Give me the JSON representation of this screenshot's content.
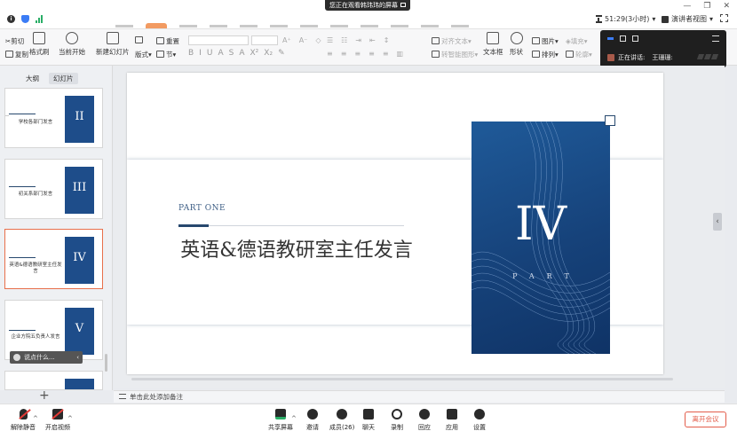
{
  "meeting": {
    "share_banner": "您正在观看韩玮玮的屏幕",
    "timer": "51:29(3小时)",
    "presenter_view": "演讲者视图"
  },
  "ribbon": {
    "cut": "剪切",
    "copy": "复制",
    "format_painter": "格式刷",
    "from_current": "当前开始",
    "new_slide": "新建幻灯片",
    "layout": "版式",
    "section": "节",
    "reset": "重置",
    "text_box": "文本框",
    "shape": "形状",
    "picture": "图片",
    "arrange": "排列",
    "align_text": "对齐文本",
    "smartart": "转智能图形",
    "fill": "填充",
    "outline": "轮廓"
  },
  "speaker_panel": {
    "label": "正在讲话:",
    "name": "王珊珊:"
  },
  "pane": {
    "tab_outline": "大纲",
    "tab_slides": "幻灯片",
    "add_slide": "+",
    "comment_placeholder": "说点什么..."
  },
  "thumbnails": [
    {
      "title": "学校各部门发言",
      "numeral": "II"
    },
    {
      "title": "初关系部门发言",
      "numeral": "III"
    },
    {
      "title": "英语&德语教研室主任发言",
      "numeral": "IV"
    },
    {
      "title": "企业方院五负责人发言",
      "numeral": "V"
    },
    {
      "title": "",
      "numeral": ""
    }
  ],
  "slide": {
    "part_label": "PART ONE",
    "title": "英语&德语教研室主任发言",
    "numeral": "IV",
    "part_letters": "PART"
  },
  "notes": {
    "placeholder": "单击此处添加备注"
  },
  "toolbar": {
    "mute": "解除静音",
    "video": "开启视频",
    "share": "共享屏幕",
    "invite": "邀请",
    "members": "成员(26)",
    "chat": "聊天",
    "record": "录制",
    "reactions": "回应",
    "apps": "应用",
    "settings": "设置",
    "leave": "离开会议"
  },
  "colors": {
    "accent": "#27486e",
    "book_blue": "#1e4d8a",
    "selection": "#e8704b",
    "leave": "#e35d4b"
  }
}
